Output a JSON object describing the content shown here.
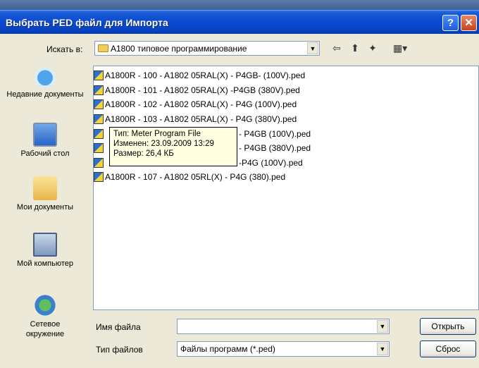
{
  "window": {
    "title": "Выбрать PED файл для Импорта",
    "help_label": "?",
    "close_label": "✕"
  },
  "lookin": {
    "label": "Искать в:",
    "value": "A1800 типовое программирование"
  },
  "toolbar": {
    "back_icon": "back-arrow-icon",
    "up_icon": "up-folder-icon",
    "newfolder_icon": "new-folder-icon",
    "view_icon": "view-menu-icon"
  },
  "places": [
    {
      "label": "Недавние документы",
      "icon": "recent-documents-icon"
    },
    {
      "label": "Рабочий стол",
      "icon": "desktop-icon"
    },
    {
      "label": "Мои документы",
      "icon": "my-documents-icon"
    },
    {
      "label": "Мой компьютер",
      "icon": "my-computer-icon"
    },
    {
      "label": "Сетевое окружение",
      "icon": "network-icon"
    }
  ],
  "files": [
    "A1800R - 100 - A1802 05RAL(X) - P4GB- (100V).ped",
    "A1800R - 101 - A1802 05RAL(X) -P4GB (380V).ped",
    "A1800R - 102 - A1802 05RAL(X) - P4G (100V).ped",
    "A1800R - 103 - A1802 05RAL(X) - P4G (380V).ped",
    "- P4GB (100V).ped",
    "- P4GB (380V).ped",
    "-P4G  (100V).ped",
    "A1800R - 107 - A1802 05RL(X) - P4G (380).ped"
  ],
  "tooltip": {
    "type": "Тип: Meter Program File",
    "modified": "Изменен: 23.09.2009 13:29",
    "size": "Размер: 26,4 КБ"
  },
  "form": {
    "filename_label": "Имя файла",
    "filename_value": "",
    "filetype_label": "Тип файлов",
    "filetype_value": "Файлы программ (*.ped)",
    "open_button": "Открыть",
    "reset_button": "Сброс"
  }
}
